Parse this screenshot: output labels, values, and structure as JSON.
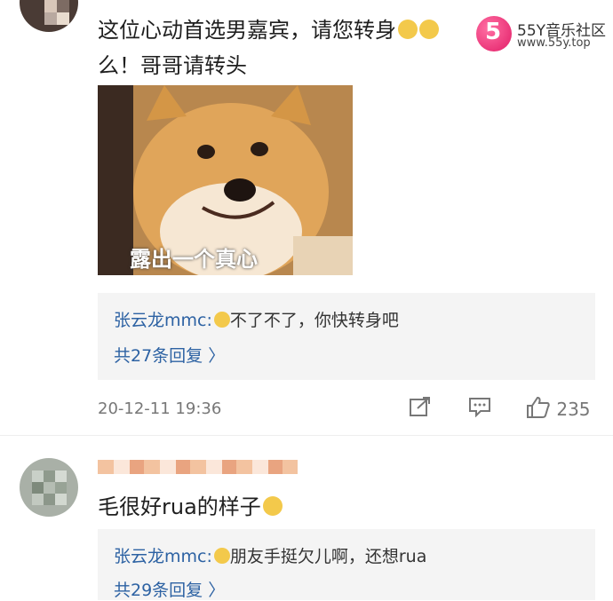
{
  "post": {
    "line1": "这位心动首选男嘉宾，请您转身",
    "line2": "么！哥哥请转头",
    "image_caption": "露出一个真心"
  },
  "watermark": {
    "digit": "5",
    "name": "55Y音乐社区",
    "url": "www.55y.top"
  },
  "reply_block_1": {
    "user": "张云龙mmc:",
    "text": "不了不了，你快转身吧",
    "count_label": "共27条回复 〉"
  },
  "meta": {
    "timestamp": "20-12-11 19:36",
    "share_icon": "share-icon",
    "comment_icon": "comment-icon",
    "like_icon": "thumbs-up-icon",
    "like_count": "235"
  },
  "comment2": {
    "text": "毛很好rua的样子"
  },
  "reply_block_2": {
    "user": "张云龙mmc:",
    "text": "朋友手挺欠儿啊，还想rua",
    "count_label": "共29条回复 〉"
  },
  "colors": {
    "link_blue": "#2d62a3",
    "meta_gray": "#777777",
    "reply_bg": "#f4f4f4"
  }
}
